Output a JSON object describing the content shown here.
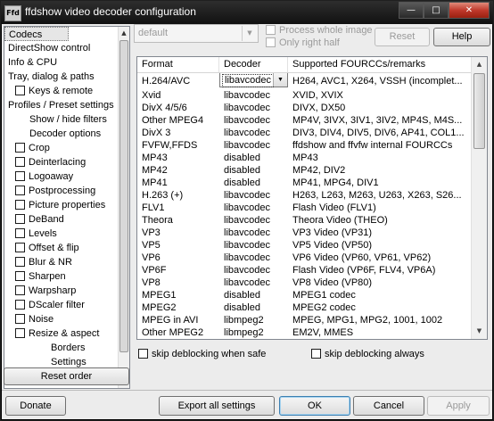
{
  "window": {
    "icon_text": "Ffd",
    "title": "ffdshow video decoder configuration",
    "minimize": "—",
    "maximize": "□",
    "close": "✕"
  },
  "tree": {
    "items": [
      {
        "label": "Codecs",
        "indent": 0,
        "checkbox": false,
        "selected": true
      },
      {
        "label": "DirectShow control",
        "indent": 0,
        "checkbox": false
      },
      {
        "label": "Info & CPU",
        "indent": 0,
        "checkbox": false
      },
      {
        "label": "Tray, dialog & paths",
        "indent": 0,
        "checkbox": false
      },
      {
        "label": "Keys & remote",
        "indent": 1,
        "checkbox": true
      },
      {
        "label": "Profiles / Preset settings",
        "indent": 0,
        "checkbox": false
      },
      {
        "label": "Show / hide filters",
        "indent": 2,
        "checkbox": false
      },
      {
        "label": "Decoder options",
        "indent": 2,
        "checkbox": false
      },
      {
        "label": "Crop",
        "indent": 1,
        "checkbox": true
      },
      {
        "label": "Deinterlacing",
        "indent": 1,
        "checkbox": true
      },
      {
        "label": "Logoaway",
        "indent": 1,
        "checkbox": true
      },
      {
        "label": "Postprocessing",
        "indent": 1,
        "checkbox": true
      },
      {
        "label": "Picture properties",
        "indent": 1,
        "checkbox": true
      },
      {
        "label": "DeBand",
        "indent": 1,
        "checkbox": true
      },
      {
        "label": "Levels",
        "indent": 1,
        "checkbox": true
      },
      {
        "label": "Offset & flip",
        "indent": 1,
        "checkbox": true
      },
      {
        "label": "Blur & NR",
        "indent": 1,
        "checkbox": true
      },
      {
        "label": "Sharpen",
        "indent": 1,
        "checkbox": true
      },
      {
        "label": "Warpsharp",
        "indent": 1,
        "checkbox": true
      },
      {
        "label": "DScaler filter",
        "indent": 1,
        "checkbox": true
      },
      {
        "label": "Noise",
        "indent": 1,
        "checkbox": true
      },
      {
        "label": "Resize & aspect",
        "indent": 1,
        "checkbox": true
      },
      {
        "label": "Borders",
        "indent": 3,
        "checkbox": false
      },
      {
        "label": "Settings",
        "indent": 3,
        "checkbox": false
      }
    ]
  },
  "reset_order": "Reset order",
  "preset": {
    "value": "default"
  },
  "options": {
    "process_whole_image": "Process whole image",
    "only_right_half": "Only right half"
  },
  "reset_button": "Reset",
  "help_button": "Help",
  "codec_table": {
    "headers": [
      "Format",
      "Decoder",
      "Supported FOURCCs/remarks"
    ],
    "rows": [
      {
        "format": "H.264/AVC",
        "decoder": "libavcodec",
        "remarks": "H264, AVC1, X264, VSSH (incomplet...",
        "dropdown": true
      },
      {
        "format": "Xvid",
        "decoder": "libavcodec",
        "remarks": "XVID, XVIX"
      },
      {
        "format": "DivX 4/5/6",
        "decoder": "libavcodec",
        "remarks": "DIVX, DX50"
      },
      {
        "format": "Other MPEG4",
        "decoder": "libavcodec",
        "remarks": "MP4V, 3IVX, 3IV1, 3IV2, MP4S, M4S..."
      },
      {
        "format": "DivX 3",
        "decoder": "libavcodec",
        "remarks": "DIV3, DIV4, DIV5, DIV6, AP41, COL1..."
      },
      {
        "format": "FVFW,FFDS",
        "decoder": "libavcodec",
        "remarks": "ffdshow and ffvfw internal FOURCCs"
      },
      {
        "format": "MP43",
        "decoder": "disabled",
        "remarks": "MP43"
      },
      {
        "format": "MP42",
        "decoder": "disabled",
        "remarks": "MP42, DIV2"
      },
      {
        "format": "MP41",
        "decoder": "disabled",
        "remarks": "MP41, MPG4, DIV1"
      },
      {
        "format": "H.263 (+)",
        "decoder": "libavcodec",
        "remarks": "H263, L263, M263, U263, X263, S26..."
      },
      {
        "format": "FLV1",
        "decoder": "libavcodec",
        "remarks": "Flash Video (FLV1)"
      },
      {
        "format": "Theora",
        "decoder": "libavcodec",
        "remarks": "Theora Video (THEO)"
      },
      {
        "format": "VP3",
        "decoder": "libavcodec",
        "remarks": "VP3 Video (VP31)"
      },
      {
        "format": "VP5",
        "decoder": "libavcodec",
        "remarks": "VP5 Video (VP50)"
      },
      {
        "format": "VP6",
        "decoder": "libavcodec",
        "remarks": "VP6 Video (VP60, VP61, VP62)"
      },
      {
        "format": "VP6F",
        "decoder": "libavcodec",
        "remarks": "Flash Video (VP6F, FLV4, VP6A)"
      },
      {
        "format": "VP8",
        "decoder": "libavcodec",
        "remarks": "VP8 Video (VP80)"
      },
      {
        "format": "MPEG1",
        "decoder": "disabled",
        "remarks": "MPEG1 codec"
      },
      {
        "format": "MPEG2",
        "decoder": "disabled",
        "remarks": "MPEG2 codec"
      },
      {
        "format": "MPEG in AVI",
        "decoder": "libmpeg2",
        "remarks": "MPEG, MPG1, MPG2, 1001, 1002"
      },
      {
        "format": "Other MPEG2",
        "decoder": "libmpeg2",
        "remarks": "EM2V, MMES"
      }
    ]
  },
  "skip_deblocking_safe": "skip deblocking when safe",
  "skip_deblocking_always": "skip deblocking always",
  "footer": {
    "donate": "Donate",
    "export": "Export all settings",
    "ok": "OK",
    "cancel": "Cancel",
    "apply": "Apply"
  },
  "icons": {
    "scroll_up": "▲",
    "scroll_down": "▼",
    "dropdown": "▼"
  }
}
